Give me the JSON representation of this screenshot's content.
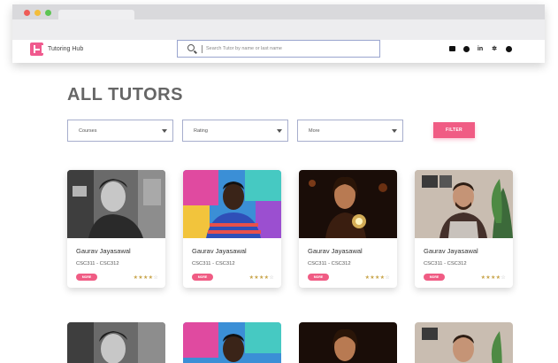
{
  "nav": {
    "brand": "Tutoring Hub",
    "search_placeholder": "Search Tutor by name or last name",
    "social_icons": [
      "mail-icon",
      "github-icon",
      "linkedin-icon",
      "dribbble-icon",
      "spotify-icon"
    ]
  },
  "page": {
    "title": "ALL TUTORS"
  },
  "filters": {
    "courses": "Courses",
    "rating": "Rating",
    "more": "More",
    "filter_button": "FILTER"
  },
  "cards": [
    {
      "name": "Gaurav Jayasawal",
      "courses": "CSC311 - CSC312",
      "more": "MORE",
      "rating": 4,
      "stars": "★★★★",
      "stars_empty": "☆"
    },
    {
      "name": "Gaurav Jayasawal",
      "courses": "CSC311 - CSC312",
      "more": "MORE",
      "rating": 4,
      "stars": "★★★★",
      "stars_empty": "☆"
    },
    {
      "name": "Gaurav Jayasawal",
      "courses": "CSC311 - CSC312",
      "more": "MORE",
      "rating": 4,
      "stars": "★★★★",
      "stars_empty": "☆"
    },
    {
      "name": "Gaurav Jayasawal",
      "courses": "CSC311 - CSC312",
      "more": "MORE",
      "rating": 4,
      "stars": "★★★★",
      "stars_empty": "☆"
    }
  ],
  "colors": {
    "accent": "#f05c84",
    "title": "#666666",
    "border": "#a7aecd"
  }
}
